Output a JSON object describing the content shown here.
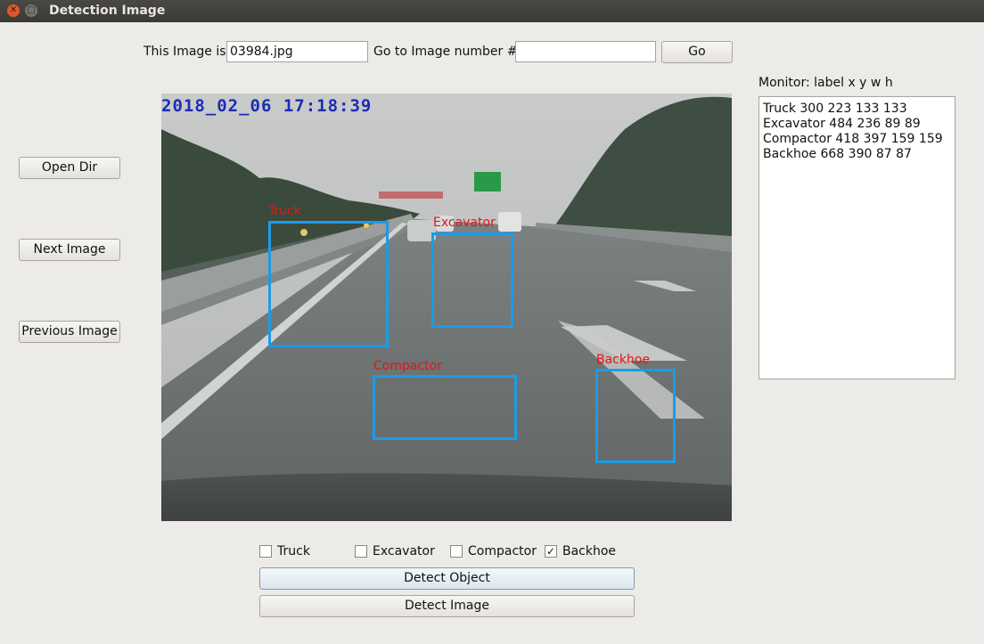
{
  "window": {
    "title": "Detection Image"
  },
  "top_bar": {
    "image_label": "This Image is",
    "image_value": "03984.jpg",
    "goto_label": "Go to Image number #",
    "goto_value": "",
    "go_button": "Go"
  },
  "side_buttons": {
    "open_dir": "Open Dir",
    "next_image": "Next Image",
    "previous_image": "Previous Image"
  },
  "image": {
    "timestamp": "2018_02_06 17:18:39",
    "detections": [
      {
        "label": "Truck"
      },
      {
        "label": "Excavator"
      },
      {
        "label": "Compactor"
      },
      {
        "label": "Backhoe"
      }
    ]
  },
  "monitor": {
    "header": "Monitor: label  x  y  w  h",
    "lines": [
      "Truck 300 223 133 133",
      "Excavator 484 236 89 89",
      "Compactor 418 397 159 159",
      "Backhoe 668 390 87 87"
    ]
  },
  "classes": [
    {
      "label": "Truck",
      "checked": false
    },
    {
      "label": "Excavator",
      "checked": false
    },
    {
      "label": "Compactor",
      "checked": false
    },
    {
      "label": "Backhoe",
      "checked": true
    }
  ],
  "actions": {
    "detect_object": "Detect Object",
    "detect_image": "Detect Image"
  },
  "colors": {
    "box": "#1c9be8",
    "box_label": "#e21616",
    "timestamp": "#1b2bb4"
  },
  "icons": {
    "close": "close-icon",
    "maximize": "maximize-icon"
  }
}
